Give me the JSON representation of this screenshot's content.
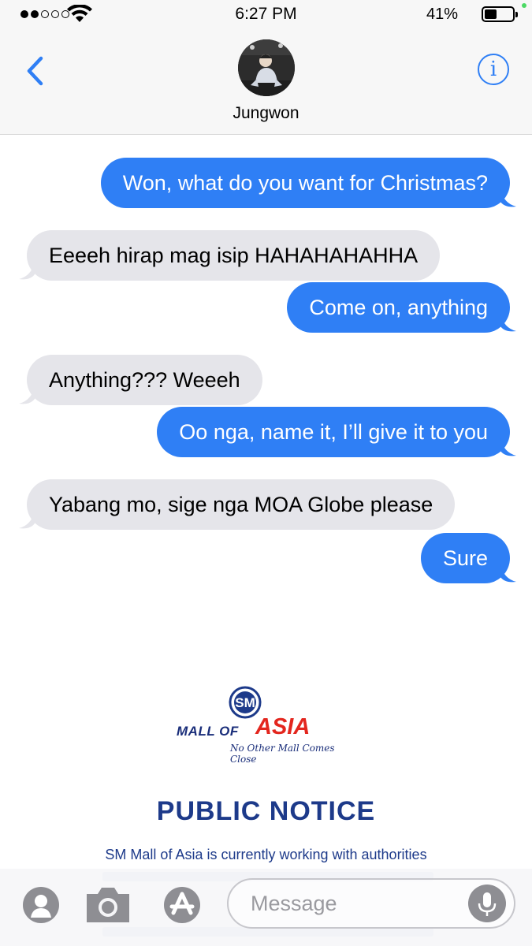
{
  "status_bar": {
    "time": "6:27 PM",
    "battery_percent": "41%",
    "signal_bars_filled": 2,
    "signal_bars_total": 5,
    "battery_level": 0.41
  },
  "header": {
    "contact_name": "Jungwon"
  },
  "messages": [
    {
      "direction": "outgoing",
      "text": "Won, what do you want for Christmas?"
    },
    {
      "direction": "incoming",
      "text": "Eeeeh hirap mag isip HAHAHAHAHHA"
    },
    {
      "direction": "outgoing",
      "text": "Come on, anything"
    },
    {
      "direction": "incoming",
      "text": "Anything??? Weeeh"
    },
    {
      "direction": "outgoing",
      "text": "Oo nga, name it, I’ll give it to you"
    },
    {
      "direction": "incoming",
      "text": "Yabang mo, sige nga MOA Globe please"
    },
    {
      "direction": "outgoing",
      "text": "Sure"
    }
  ],
  "attachment": {
    "logo_badge": "SM",
    "logo_brand_part1": "MALL OF ",
    "logo_brand_part2": "ASIA",
    "logo_tagline": "No Other Mall Comes Close",
    "title": "PUBLIC NOTICE",
    "body": "SM Mall of Asia is currently working with authorities"
  },
  "input_bar": {
    "placeholder": "Message"
  },
  "colors": {
    "outgoing_bubble": "#2f7ff5",
    "incoming_bubble": "#e5e5ea",
    "ios_blue": "#2f7ff5",
    "brand_blue": "#1d3a8a",
    "brand_red": "#e3261e"
  }
}
